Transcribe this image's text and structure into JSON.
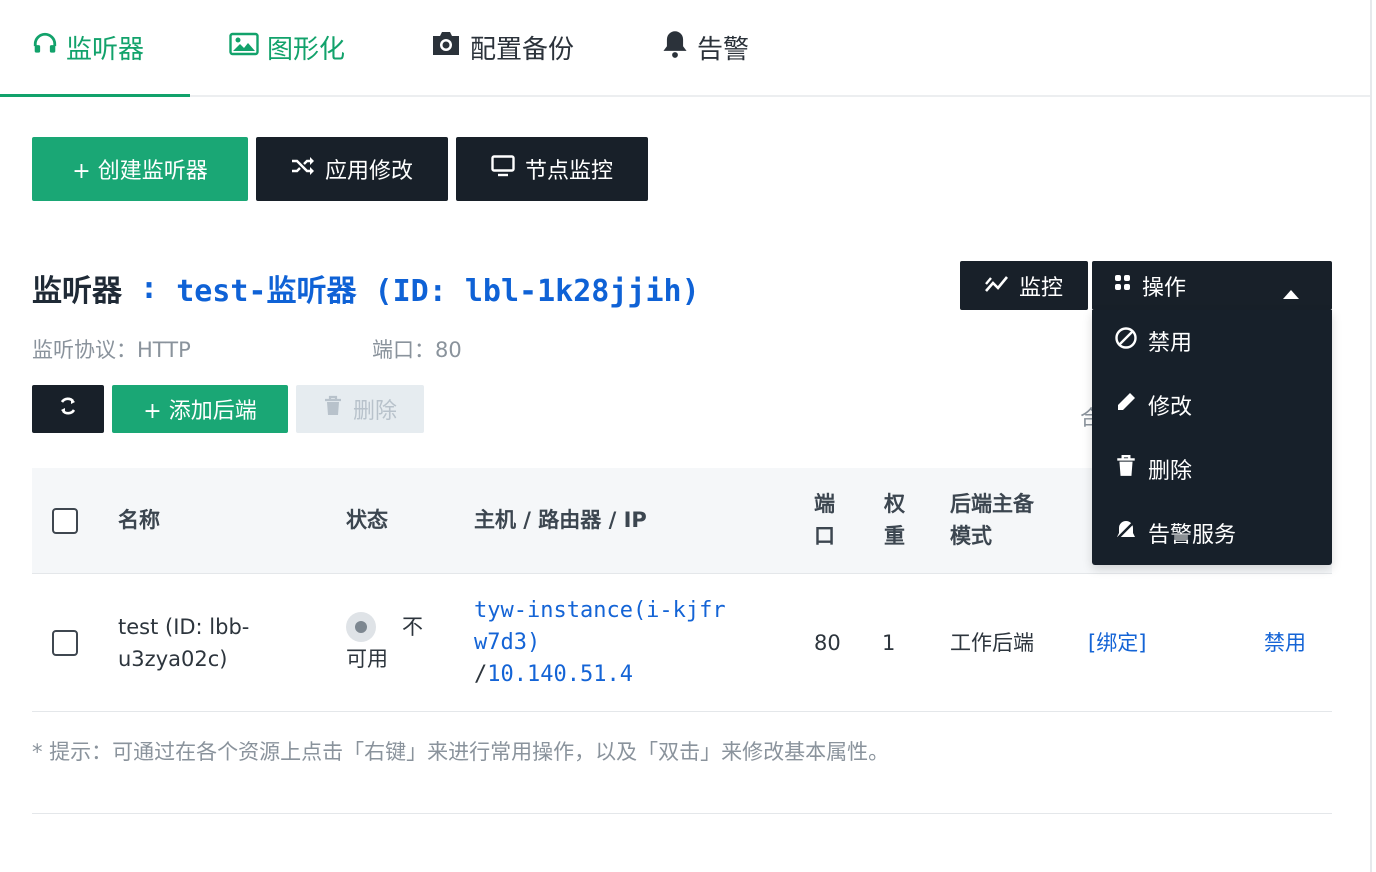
{
  "tabs": [
    {
      "label": "监听器",
      "icon": "headphones-icon"
    },
    {
      "label": "图形化",
      "icon": "image-icon"
    },
    {
      "label": "配置备份",
      "icon": "camera-icon"
    },
    {
      "label": "告警",
      "icon": "bell-icon"
    }
  ],
  "toolbar": {
    "create_label": "+ 创建监听器",
    "apply_label": "应用修改",
    "node_monitor_label": "节点监控"
  },
  "header": {
    "prefix": "监听器",
    "separator": " : ",
    "name": "test-监听器 (ID: lbl-1k28jjih)",
    "monitor_label": "监控",
    "actions_label": "操作",
    "protocol": "监听协议：HTTP",
    "port": "端口：80"
  },
  "actions": {
    "add_backend_label": "+ 添加后端",
    "delete_label": "删除"
  },
  "dropdown": {
    "items": [
      {
        "label": "禁用",
        "icon": "ban-icon"
      },
      {
        "label": "修改",
        "icon": "pencil-icon"
      },
      {
        "label": "删除",
        "icon": "trash-icon"
      },
      {
        "label": "告警服务",
        "icon": "bell-slash-icon"
      }
    ]
  },
  "partial_text": "合",
  "table": {
    "headers": {
      "name": "名称",
      "status": "状态",
      "host": "主机 / 路由器 / IP",
      "port_l1": "端",
      "port_l2": "口",
      "weight_l1": "权",
      "weight_l2": "重",
      "mode_l1": "后端主备",
      "mode_l2": "模式"
    },
    "rows": [
      {
        "name_l1": "test (ID: lbb-",
        "name_l2": "u3zya02c)",
        "status_l1": "不",
        "status_l2": "可用",
        "host_l1": "tyw-instance(i-kjfr",
        "host_l2": "w7d3)",
        "host_l3_sep": "/",
        "host_l3": "10.140.51.4",
        "port": "80",
        "weight": "1",
        "mode": "工作后端",
        "bind": "[绑定]",
        "disable": "禁用"
      }
    ]
  },
  "hint": "* 提示：可通过在各个资源上点击「右键」来进行常用操作，以及「双击」来修改基本属性。",
  "colors": {
    "accent": "#12a26b",
    "dark": "#182029",
    "link": "#1464d6"
  }
}
